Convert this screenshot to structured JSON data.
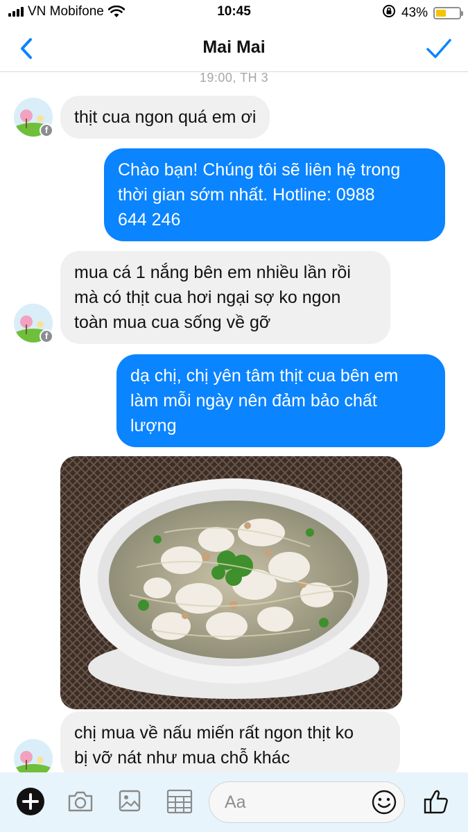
{
  "status": {
    "carrier": "VN Mobifone",
    "time": "10:45",
    "battery_text": "43%",
    "battery_level": 0.43,
    "battery_color": "#f5c400"
  },
  "nav": {
    "back_icon": "chevron-left-icon",
    "title": "Mai Mai",
    "check_icon": "checkmark-icon"
  },
  "conversation": {
    "timestamp": "19:00, TH 3",
    "messages": [
      {
        "sender": "contact",
        "text": "thịt cua ngon quá em ơi"
      },
      {
        "sender": "me",
        "lines": [
          "Chào bạn! Chúng tôi sẽ liên hệ trong",
          "thời gian sớm nhất. Hotline: 0988",
          "644 246"
        ]
      },
      {
        "sender": "contact",
        "lines": [
          "mua cá 1 nắng bên em nhiều lần rồi",
          "mà có thịt cua hơi ngại sợ ko ngon",
          "toàn mua cua sống về gỡ"
        ]
      },
      {
        "sender": "me",
        "lines": [
          "dạ chị, chị yên tâm thịt cua bên em",
          "làm mỗi ngày nên đảm bảo chất",
          "lượng"
        ]
      },
      {
        "sender": "contact",
        "type": "photo",
        "description_icon": "crab-noodle-soup-photo"
      },
      {
        "sender": "contact",
        "lines": [
          "chị mua về nấu miến rất ngon thịt ko",
          "bị vỡ nát như mua chỗ khác"
        ]
      }
    ]
  },
  "composer": {
    "placeholder": "Aa",
    "icons": [
      "plus-icon",
      "camera-icon",
      "photo-icon",
      "sticker-grid-icon",
      "emoji-icon",
      "thumbs-up-icon"
    ]
  },
  "colors": {
    "outgoing_bubble": "#0a84ff",
    "incoming_bubble": "#f0f0f0",
    "accent": "#0a84ff",
    "composer_bg": "#e8f4fb"
  }
}
